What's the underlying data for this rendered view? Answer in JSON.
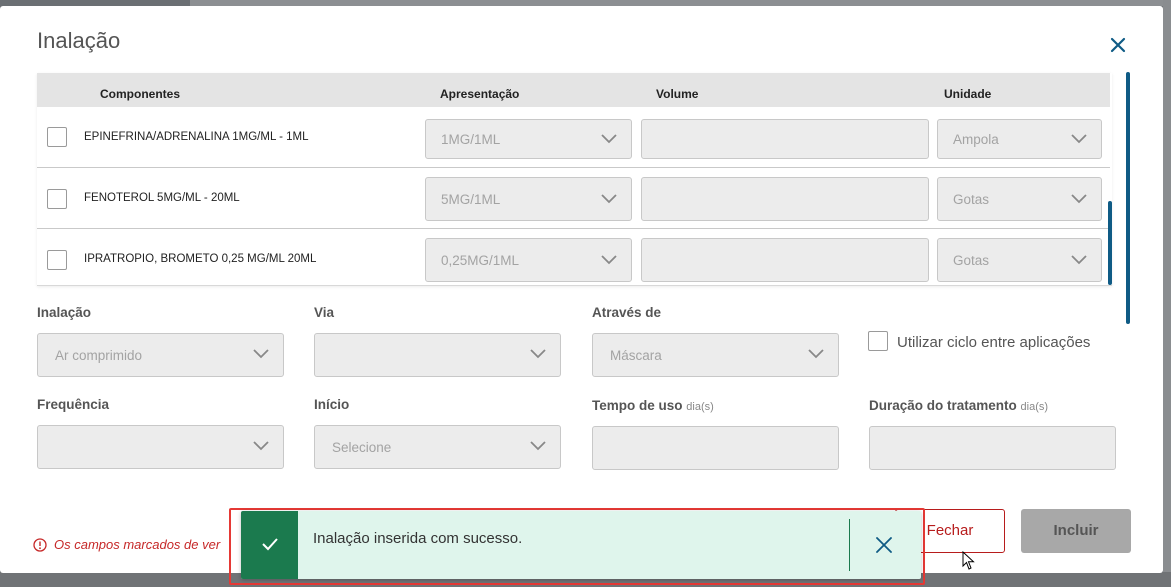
{
  "modal": {
    "title": "Inalação"
  },
  "table": {
    "headers": {
      "components": "Componentes",
      "presentation": "Apresentação",
      "volume": "Volume",
      "unit": "Unidade"
    },
    "rows": [
      {
        "name": "EPINEFRINA/ADRENALINA 1MG/ML - 1ML",
        "presentation": "1MG/1ML",
        "volume": "",
        "unit": "Ampola"
      },
      {
        "name": "FENOTEROL 5MG/ML - 20ML",
        "presentation": "5MG/1ML",
        "volume": "",
        "unit": "Gotas"
      },
      {
        "name": "IPRATROPIO, BROMETO 0,25 MG/ML 20ML",
        "presentation": "0,25MG/1ML",
        "volume": "",
        "unit": "Gotas"
      }
    ]
  },
  "form": {
    "inhalation_label": "Inalação",
    "inhalation_value": "Ar comprimido",
    "route_label": "Via",
    "route_value": "",
    "through_label": "Através de",
    "through_value": "Máscara",
    "cycle_checkbox_label": "Utilizar ciclo entre aplicações",
    "frequency_label": "Frequência",
    "frequency_value": "",
    "start_label": "Início",
    "start_placeholder": "Selecione",
    "usage_time_label": "Tempo de uso",
    "usage_time_unit": "dia(s)",
    "duration_label": "Duração do tratamento",
    "duration_unit": "dia(s)"
  },
  "footer": {
    "required_note": "Os campos marcados de ver",
    "close_button": "Fechar",
    "include_button": "Incluir"
  },
  "toast": {
    "message": "Inalação inserida com sucesso.",
    "accent_color": "#1b7a4e",
    "background_color": "#dff5ec"
  },
  "icons": {
    "close": "close-icon",
    "chevron": "chevron-down-icon",
    "check": "check-icon",
    "info": "info-circle-icon"
  }
}
